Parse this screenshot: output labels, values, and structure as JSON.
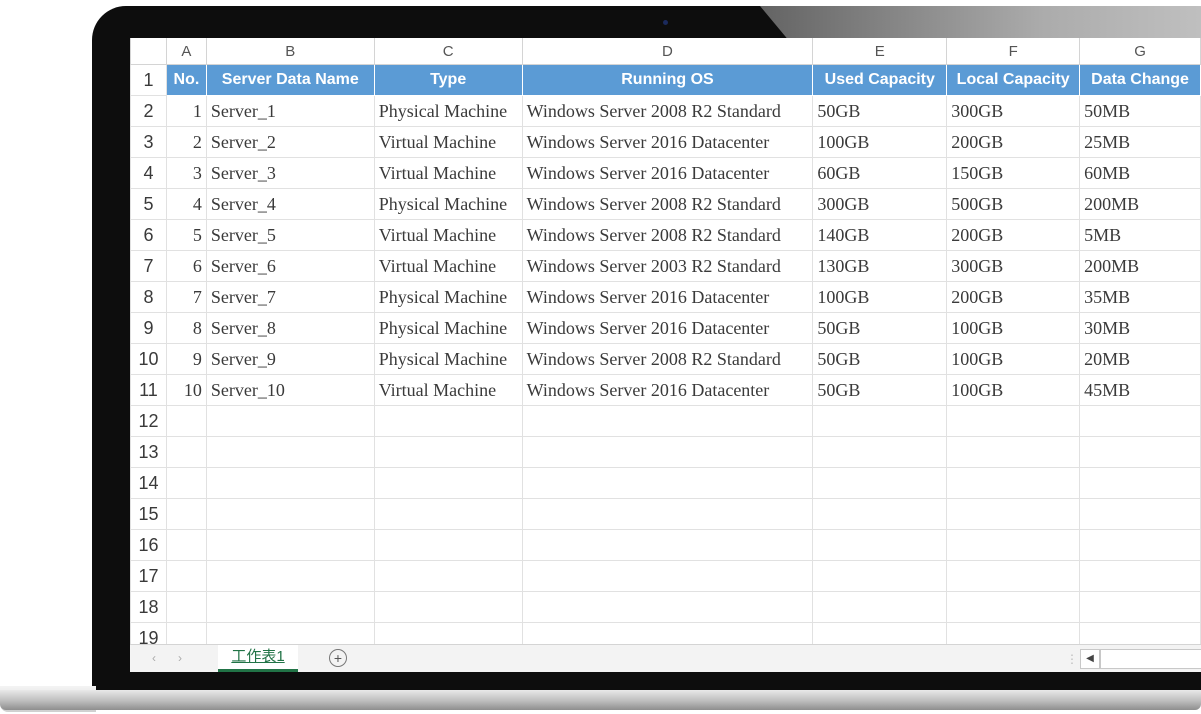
{
  "sheet": {
    "column_letters": [
      "A",
      "B",
      "C",
      "D",
      "E",
      "F",
      "G"
    ],
    "header": [
      "No.",
      "Server Data Name",
      "Type",
      "Running OS",
      "Used Capacity",
      "Local Capacity",
      "Data Change"
    ],
    "row_numbers": [
      "1",
      "2",
      "3",
      "4",
      "5",
      "6",
      "7",
      "8",
      "9",
      "10",
      "11",
      "12",
      "13",
      "14",
      "15",
      "16",
      "17",
      "18",
      "19"
    ],
    "rows": [
      [
        "1",
        "Server_1",
        "Physical Machine",
        "Windows Server 2008 R2 Standard",
        "50GB",
        "300GB",
        "50MB"
      ],
      [
        "2",
        "Server_2",
        "Virtual Machine",
        "Windows Server 2016 Datacenter",
        "100GB",
        "200GB",
        "25MB"
      ],
      [
        "3",
        "Server_3",
        "Virtual Machine",
        "Windows Server 2016 Datacenter",
        "60GB",
        "150GB",
        "60MB"
      ],
      [
        "4",
        "Server_4",
        "Physical Machine",
        "Windows Server 2008 R2 Standard",
        "300GB",
        "500GB",
        "200MB"
      ],
      [
        "5",
        "Server_5",
        "Virtual Machine",
        "Windows Server 2008 R2 Standard",
        "140GB",
        "200GB",
        "5MB"
      ],
      [
        "6",
        "Server_6",
        "Virtual Machine",
        "Windows Server 2003 R2 Standard",
        "130GB",
        "300GB",
        "200MB"
      ],
      [
        "7",
        "Server_7",
        "Physical Machine",
        "Windows Server 2016 Datacenter",
        "100GB",
        "200GB",
        "35MB"
      ],
      [
        "8",
        "Server_8",
        "Physical Machine",
        "Windows Server 2016 Datacenter",
        "50GB",
        "100GB",
        "30MB"
      ],
      [
        "9",
        "Server_9",
        "Physical Machine",
        "Windows Server 2008 R2 Standard",
        "50GB",
        "100GB",
        "20MB"
      ],
      [
        "10",
        "Server_10",
        "Virtual Machine",
        "Windows Server 2016 Datacenter",
        "50GB",
        "100GB",
        "45MB"
      ]
    ]
  },
  "tabbar": {
    "prev_sheet_icon": "chevron-left-icon",
    "next_sheet_icon": "chevron-right-icon",
    "active_sheet": "工作表1",
    "add_sheet_symbol": "+",
    "scroll_left_symbol": "◀"
  },
  "colors": {
    "header_fill": "#5b9bd5",
    "active_tab": "#217346"
  }
}
